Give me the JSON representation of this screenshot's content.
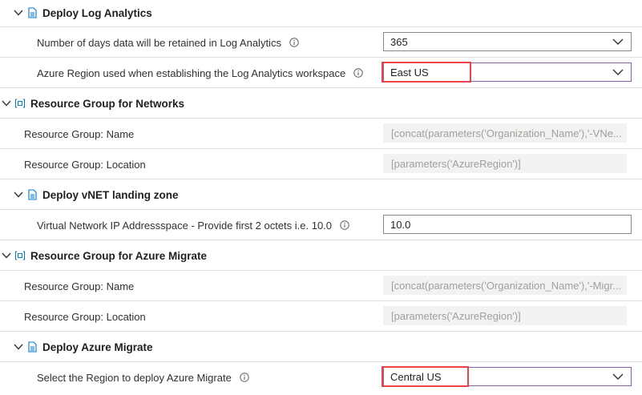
{
  "sections": {
    "deploy_log_analytics": {
      "title": "Deploy Log Analytics"
    },
    "rg_networks": {
      "title": "Resource Group for Networks"
    },
    "deploy_vnet": {
      "title": "Deploy vNET landing zone"
    },
    "rg_migrate": {
      "title": "Resource Group for Azure Migrate"
    },
    "deploy_migrate": {
      "title": "Deploy Azure Migrate"
    }
  },
  "fields": {
    "retention_days": {
      "label": "Number of days data will be retained in Log Analytics",
      "value": "365"
    },
    "la_region": {
      "label": "Azure Region used when establishing the Log Analytics workspace",
      "value": "East US"
    },
    "net_rg_name": {
      "label": "Resource Group: Name",
      "value": "[concat(parameters('Organization_Name'),'-VNe..."
    },
    "net_rg_location": {
      "label": "Resource Group: Location",
      "value": "[parameters('AzureRegion')]"
    },
    "vnet_ip": {
      "label": "Virtual Network IP Addressspace - Provide first 2 octets i.e. 10.0",
      "value": "10.0"
    },
    "mig_rg_name": {
      "label": "Resource Group: Name",
      "value": "[concat(parameters('Organization_Name'),'-Migr..."
    },
    "mig_rg_location": {
      "label": "Resource Group: Location",
      "value": "[parameters('AzureRegion')]"
    },
    "migrate_region": {
      "label": "Select the Region to deploy Azure Migrate",
      "value": "Central US"
    }
  },
  "colors": {
    "highlight": "#e8454a",
    "focus_border": "#8c5fb5",
    "readonly_bg": "#f3f2f1"
  },
  "icons": {
    "expand": "chevron-down-icon",
    "template": "document-icon",
    "resource_group": "resource-group-icon",
    "info": "info-icon"
  }
}
